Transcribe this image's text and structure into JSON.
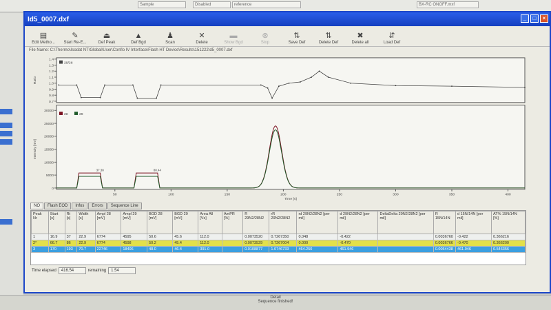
{
  "background_window": {
    "cells": [
      "Sample",
      "Disabled",
      "reference",
      "BX-RC ONOFF.mxf",
      "BX-RC ONOFF.mxf"
    ]
  },
  "window": {
    "title": "Id5_0007.dxf",
    "min": "_",
    "max": "□",
    "close": "×"
  },
  "toolbar": [
    {
      "label": "Edit Metho...",
      "icon": "▤",
      "enabled": true
    },
    {
      "label": "Start Re-E...",
      "icon": "✎",
      "enabled": true
    },
    {
      "label": "Def Peak",
      "icon": "⏏",
      "enabled": true
    },
    {
      "label": "Def Bgd",
      "icon": "▲",
      "enabled": true
    },
    {
      "label": "Scan",
      "icon": "♟",
      "enabled": true
    },
    {
      "label": "Delete",
      "icon": "✕",
      "enabled": true
    },
    {
      "label": "Show Bgd",
      "icon": "▬",
      "enabled": false
    },
    {
      "label": "Stop",
      "icon": "⊗",
      "enabled": false
    },
    {
      "label": "Save Def",
      "icon": "⇅",
      "enabled": true
    },
    {
      "label": "Delete Def",
      "icon": "⇅",
      "enabled": true
    },
    {
      "label": "Delete all",
      "icon": "✖",
      "enabled": true
    },
    {
      "label": "Load Def",
      "icon": "⇵",
      "enabled": true
    }
  ],
  "file_name": "File Name:  C:\\Thermo\\Isodat NT\\Global\\User\\Conflo IV Interface\\Flash HT Device\\Results\\151222\\d5_0007.dxf",
  "chart_data": [
    {
      "type": "line",
      "title": "",
      "ylabel": "Ratio",
      "xlabel": "",
      "legend": [
        "29/28"
      ],
      "ylim": [
        0.7,
        1.4
      ],
      "yticks": [
        "1.4",
        "1.3",
        "1.2",
        "1.1",
        "1.0",
        "0.9",
        "0.8",
        "0.7"
      ],
      "xlim": [
        -2,
        415
      ],
      "series": [
        {
          "name": "29/28",
          "color": "#444444",
          "x": [
            0,
            16,
            20,
            37,
            41,
            66,
            70,
            87,
            91,
            180,
            186,
            190,
            196,
            205,
            215,
            225,
            232,
            240,
            260,
            300,
            350,
            415
          ],
          "y": [
            0.97,
            0.97,
            0.76,
            0.76,
            0.97,
            0.97,
            0.75,
            0.75,
            0.97,
            0.97,
            0.92,
            0.75,
            0.95,
            1.0,
            1.02,
            1.1,
            1.2,
            1.1,
            1.0,
            0.96,
            0.95,
            0.93
          ]
        }
      ]
    },
    {
      "type": "line",
      "title": "",
      "ylabel": "Intensity [mV]",
      "xlabel": "Time [s]",
      "legend": [
        "28",
        "29"
      ],
      "ylim": [
        0,
        30000
      ],
      "yticks": [
        "30000",
        "25000",
        "20000",
        "15000",
        "10000",
        "5000",
        "0"
      ],
      "xlim": [
        -2,
        415
      ],
      "xticks": [
        "50",
        "100",
        "150",
        "200",
        "250",
        "300",
        "350",
        "400"
      ],
      "annotations": [
        "37.38",
        "88.44"
      ],
      "series": [
        {
          "name": "28",
          "color": "#7a1020",
          "plateaus": [
            [
              16,
              37,
              5800
            ],
            [
              67,
              88,
              5800
            ]
          ],
          "peak": {
            "center": 193,
            "height": 24000,
            "sigma": 5.5
          }
        },
        {
          "name": "29",
          "color": "#1f5a2a",
          "plateaus": [
            [
              16,
              37,
              4500
            ],
            [
              67,
              88,
              4500
            ]
          ],
          "peak": {
            "center": 193,
            "height": 22500,
            "sigma": 5.5
          }
        }
      ]
    }
  ],
  "tabs": [
    "NO",
    "Flash EOD",
    "Infos",
    "Errors",
    "Sequence Line"
  ],
  "table": {
    "headers": [
      "Peak Nr",
      "Start [s]",
      "Rt [s]",
      "Width [s]",
      "Ampl 28 [mV]",
      "Ampl 29 [mV]",
      "BGD 28 [mV]",
      "BGD 29 [mV]",
      "Area All [Vs]",
      "AmPR [%]",
      "R 29N2/28N2",
      "rR 29N2/28N2",
      "rd 29N2/28N2 [per mil]",
      "d 29N2/28N2 [per mil]",
      "DeltaDelta 29N2/28N2 [per mil]",
      "R 15N/14N",
      "d 15N/14N [per mil]",
      "AT% 15N/14N [%]"
    ],
    "rows": [
      [
        "1",
        "16.9",
        "37",
        "22.9",
        "6774",
        "4595",
        "50.6",
        "45.6",
        "112.0",
        "",
        "0.0073520",
        "0.7267350",
        "0.048",
        "-0.422",
        "",
        "0.0036760",
        "-0.422",
        "0.366216"
      ],
      [
        "2*",
        "66.7",
        "86",
        "22.9",
        "6774",
        "4598",
        "50.2",
        "45.4",
        "112.0",
        "",
        "0.0073529",
        "0.7267004",
        "0.000",
        "-0.470",
        "",
        "0.0036766",
        "-0.470",
        "0.366200"
      ],
      [
        "3",
        "170",
        "193",
        "70.7",
        "22746",
        "18406",
        "48.0",
        "46.4",
        "391.0",
        "",
        "0.0108877",
        "1.0746733",
        "464.250",
        "461.946",
        "",
        "0.0054438",
        "461.946",
        "0.546356"
      ]
    ]
  },
  "elapsed": {
    "label": "Time elapsed",
    "value": "416.54",
    "remaining_label": "remaining",
    "remaining": "1.54"
  },
  "status": {
    "line1": "Detail",
    "line2": "Sequence finished!"
  }
}
